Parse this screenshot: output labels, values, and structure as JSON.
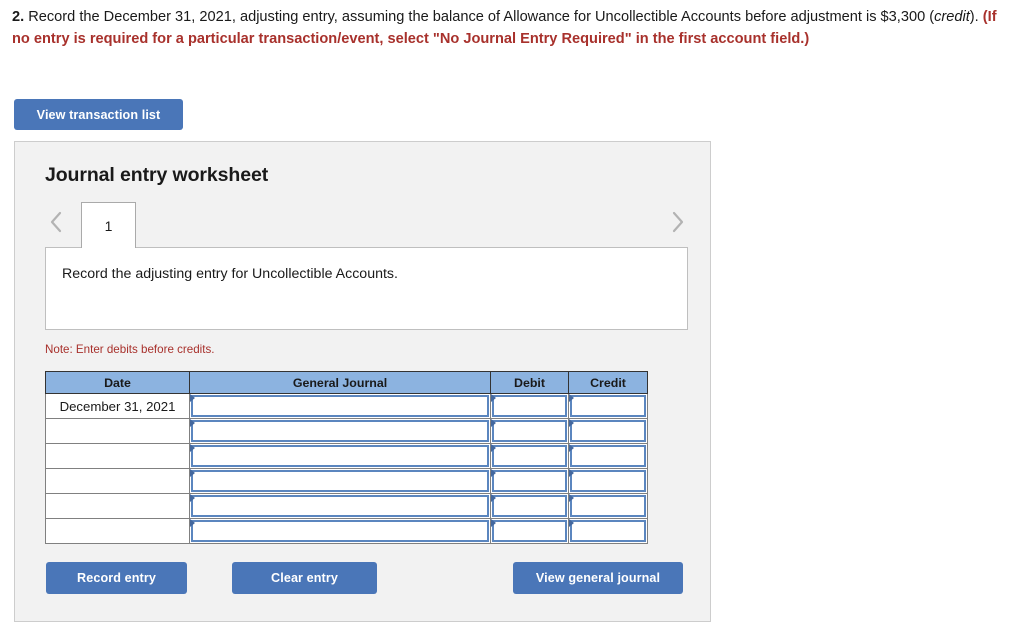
{
  "prompt": {
    "number": "2.",
    "body_part1": " Record the December 31, 2021, adjusting entry, assuming the balance of Allowance for Uncollectible Accounts before adjustment is $3,300 (",
    "italic_word": "credit",
    "body_part2": "). ",
    "red_instruction": "(If no entry is required for a particular transaction/event, select \"No Journal Entry Required\" in the first account field.)"
  },
  "toolbar": {
    "view_transaction_list_label": "View transaction list"
  },
  "worksheet": {
    "title": "Journal entry worksheet",
    "prev_icon": "chevron-left-icon",
    "next_icon": "chevron-right-icon",
    "tabs": [
      {
        "label": "1",
        "selected": true
      }
    ],
    "instruction": "Record the adjusting entry for Uncollectible Accounts.",
    "note": "Note: Enter debits before credits."
  },
  "table": {
    "headers": [
      "Date",
      "General Journal",
      "Debit",
      "Credit"
    ],
    "rows": [
      {
        "date": "December 31, 2021",
        "general_journal": "",
        "debit": "",
        "credit": ""
      },
      {
        "date": "",
        "general_journal": "",
        "debit": "",
        "credit": ""
      },
      {
        "date": "",
        "general_journal": "",
        "debit": "",
        "credit": ""
      },
      {
        "date": "",
        "general_journal": "",
        "debit": "",
        "credit": ""
      },
      {
        "date": "",
        "general_journal": "",
        "debit": "",
        "credit": ""
      },
      {
        "date": "",
        "general_journal": "",
        "debit": "",
        "credit": ""
      }
    ]
  },
  "footer": {
    "record_entry_label": "Record entry",
    "clear_entry_label": "Clear entry",
    "view_general_journal_label": "View general journal"
  },
  "colors": {
    "button_blue": "#4a76b8",
    "table_header_blue": "#8cb3e0",
    "input_border_blue": "#5b86bf",
    "red_text": "#a8312c",
    "panel_background": "#f2f2f2"
  }
}
